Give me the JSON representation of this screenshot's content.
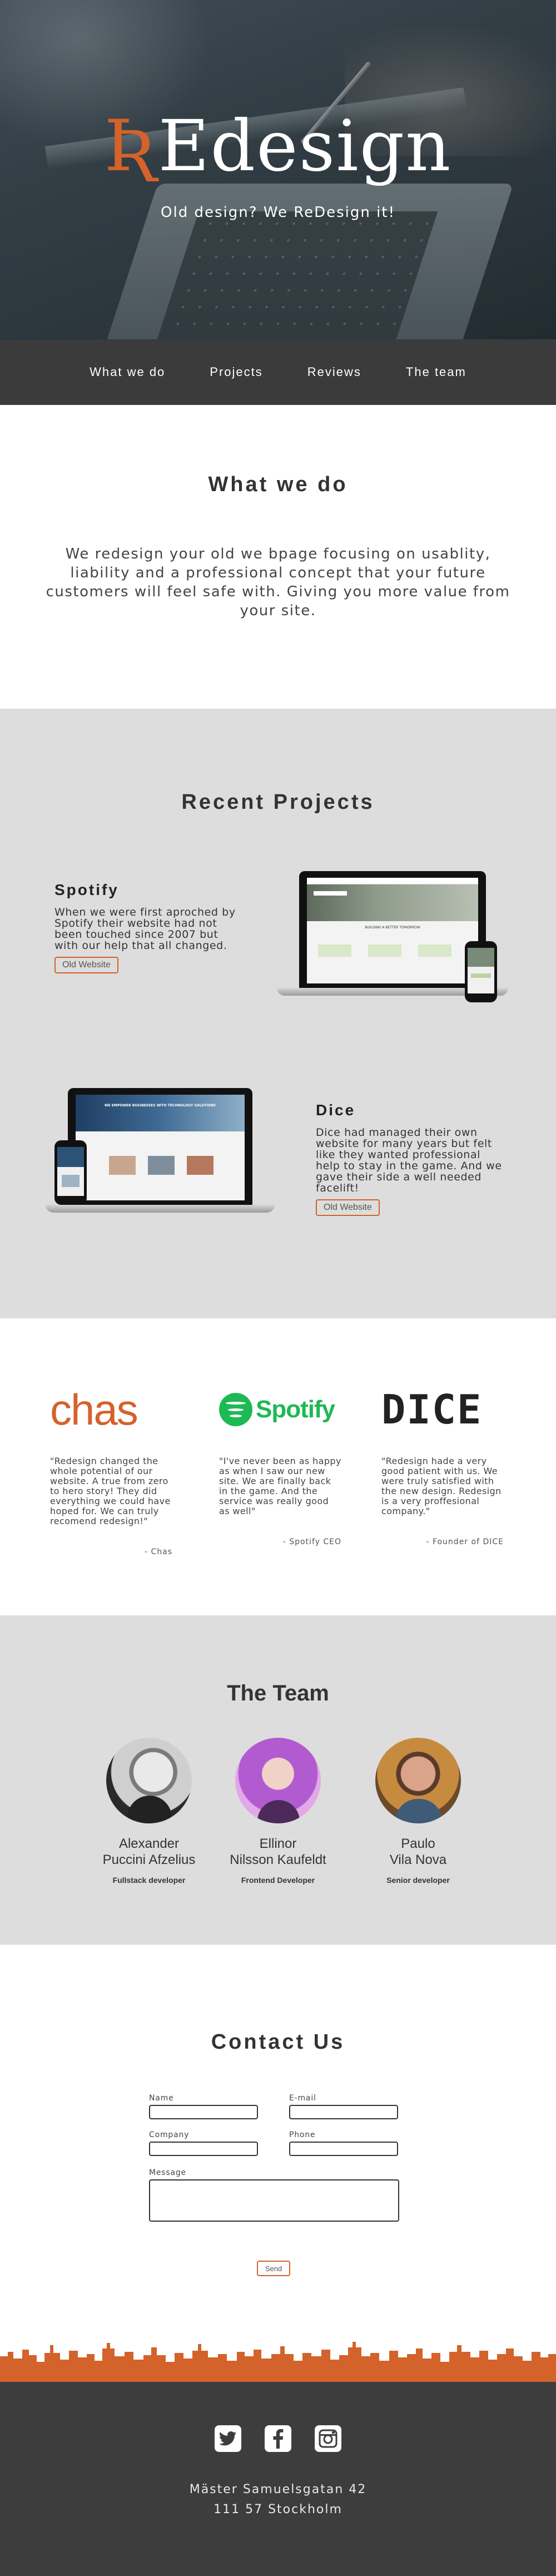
{
  "hero": {
    "logo_mark": "Ʀ",
    "logo_word": "Edesign",
    "tagline": "Old design? We ReDesign it!"
  },
  "nav": {
    "items": [
      {
        "label": "What we do"
      },
      {
        "label": "Projects"
      },
      {
        "label": "Reviews"
      },
      {
        "label": "The team"
      }
    ]
  },
  "what_we_do": {
    "title": "What we do",
    "text": "We redesign your old we bpage focusing on usablity, liability and a professional concept that your future customers will feel safe with. Giving you more value from your site."
  },
  "projects": {
    "title": "Recent Projects",
    "items": [
      {
        "name": "Spotify",
        "text": "When we were first aproched by Spotify their website had not been touched since 2007 but with our help that all changed.",
        "button": "Old Website",
        "screen_text": "BUILDING A BETTER TOMORROW"
      },
      {
        "name": "Dice",
        "text": "Dice had managed their own website for many years but felt like they wanted professional help to stay in the game. And we gave their side a well needed facelift!",
        "button": "Old Website",
        "screen_text": "WE EMPOWER BUSINESSES WITH TECHNOLOGY SOLUTIONS"
      }
    ]
  },
  "reviews": {
    "items": [
      {
        "logo": "chas",
        "quote": "\"Redesign changed the whole potential of our website. A true from zero to hero story! They did everything we could have hoped for. We can truly recomend redesign!\"",
        "author": "- Chas"
      },
      {
        "logo": "Spotify",
        "quote": "\"I've never been as happy as when I saw our new site. We are finally back in the game. And the service was really good as well\"",
        "author": "- Spotify CEO"
      },
      {
        "logo": "DICE",
        "quote": "\"Redesign hade a very good patient with us. We were truly satisfied with the new design. Redesign is a very proffesional company.\"",
        "author": "- Founder of DICE"
      }
    ]
  },
  "team": {
    "title": "The Team",
    "members": [
      {
        "first": "Alexander",
        "last": "Puccini Afzelius",
        "role": "Fullstack developer"
      },
      {
        "first": "Ellinor",
        "last": "Nilsson Kaufeldt",
        "role": "Frontend Developer"
      },
      {
        "first": "Paulo",
        "last": "Vila Nova",
        "role": "Senior developer"
      }
    ]
  },
  "contact": {
    "title": "Contact Us",
    "labels": {
      "name": "Name",
      "email": "E-mail",
      "company": "Company",
      "phone": "Phone",
      "message": "Message"
    },
    "send": "Send"
  },
  "footer": {
    "social": [
      "twitter-icon",
      "facebook-icon",
      "instagram-icon"
    ],
    "address_line1": "Mäster Samuelsgatan 42",
    "address_line2": "111 57 Stockholm"
  },
  "colors": {
    "accent": "#d4622b",
    "nav_bg": "#3b3b3b",
    "section_gray": "#dddddd",
    "footer_bg": "#3d3d3d",
    "spotify_green": "#1db954"
  }
}
